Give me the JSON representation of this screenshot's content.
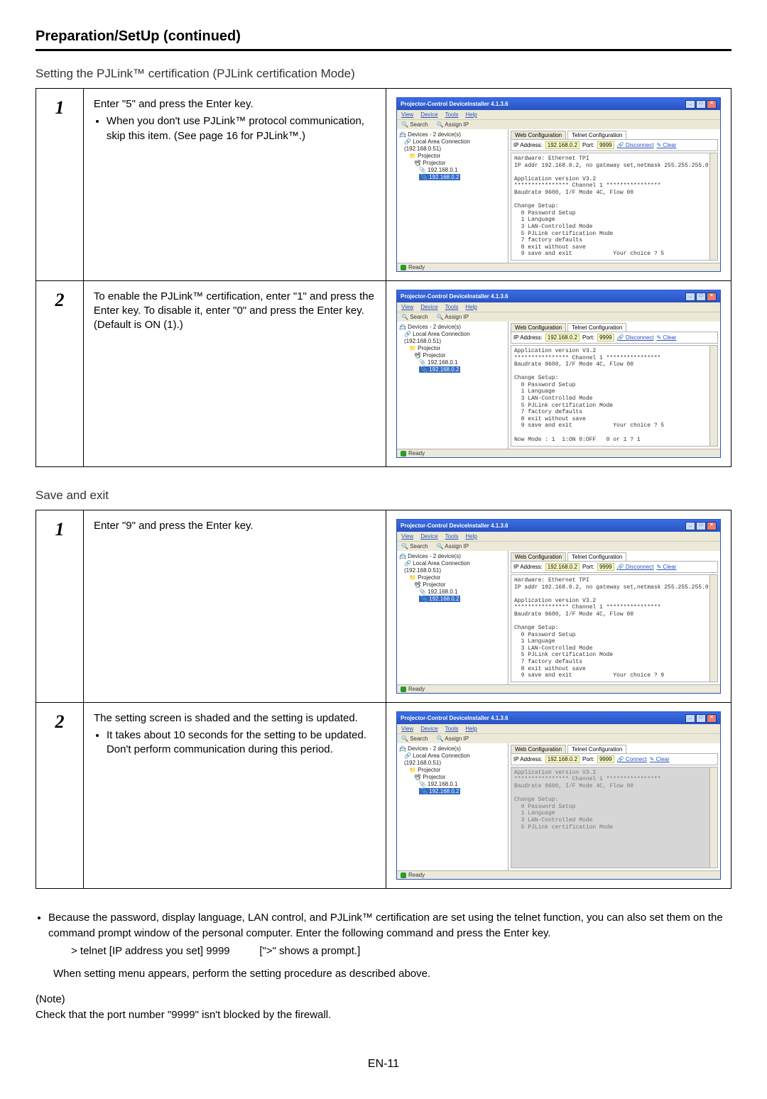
{
  "header": {
    "page_title": "Preparation/SetUp (continued)"
  },
  "section_pjlink": {
    "heading": "Setting the PJLink™ certification (PJLink certification Mode)",
    "rows": [
      {
        "num": "1",
        "desc_main": "Enter \"5\" and press the Enter key.",
        "desc_bullets": [
          "When you don't use PJLink™ protocol communication, skip this item. (See page 16 for PJLink™.)"
        ],
        "terminal_text": "Hardware: Ethernet TPI\nIP addr 192.168.0.2, no gateway set,netmask 255.255.255.0\n\nApplication version V3.2\n**************** Channel 1 ****************\nBaudrate 9600, I/F Mode 4C, Flow 00\n\nChange Setup:\n  0 Password Setup\n  1 Language\n  3 LAN-Controlled Mode\n  5 PJLink certification Mode\n  7 factory defaults\n  8 exit without save\n  9 save and exit            Your choice ? 5",
        "addr_btn": "Disconnect",
        "shaded": false
      },
      {
        "num": "2",
        "desc_main": "To enable the PJLink™ certification, enter \"1\" and press the Enter key. To disable it, enter \"0\" and press the Enter key. (Default is ON (1).)",
        "desc_bullets": [],
        "terminal_text": "Application version V3.2\n**************** Channel 1 ****************\nBaudrate 9600, I/F Mode 4C, Flow 00\n\nChange Setup:\n  0 Password Setup\n  1 Language\n  3 LAN-Controlled Mode\n  5 PJLink certification Mode\n  7 factory defaults\n  8 exit without save\n  9 save and exit            Your choice ? 5\n\nNow Mode : 1  1:ON 0:OFF   0 or 1 ? 1",
        "addr_btn": "Disconnect",
        "shaded": false
      }
    ]
  },
  "section_save": {
    "heading": "Save and exit",
    "rows": [
      {
        "num": "1",
        "desc_main": "Enter \"9\" and press the Enter key.",
        "desc_bullets": [],
        "terminal_text": "Hardware: Ethernet TPI\nIP addr 192.168.0.2, no gateway set,netmask 255.255.255.0\n\nApplication version V3.2\n**************** Channel 1 ****************\nBaudrate 9600, I/F Mode 4C, Flow 00\n\nChange Setup:\n  0 Password Setup\n  1 Language\n  3 LAN-Controlled Mode\n  5 PJLink certification Mode\n  7 factory defaults\n  8 exit without save\n  9 save and exit            Your choice ? 9",
        "addr_btn": "Disconnect",
        "shaded": false
      },
      {
        "num": "2",
        "desc_main": "The setting screen is shaded and the setting is updated.",
        "desc_bullets": [
          "It takes about 10 seconds for the setting to be updated. Don't perform communication during this period."
        ],
        "terminal_text": "Application version V3.2\n**************** Channel 1 ****************\nBaudrate 9600, I/F Mode 4C, Flow 00\n\nChange Setup:\n  0 Password Setup\n  1 Language\n  3 LAN-Controlled Mode\n  5 PJLink certification Mode",
        "addr_btn": "Connect",
        "shaded": true
      }
    ]
  },
  "screenshot_common": {
    "window_title": "Projector-Control DeviceInstaller 4.1.3.6",
    "menus": [
      "View",
      "Device",
      "Tools",
      "Help"
    ],
    "tool_search": "Search",
    "tool_assign": "Assign IP",
    "tree": {
      "root": "Devices - 2 device(s)",
      "conn": "Local Area Connection (192.168.0.51)",
      "folder": "Projector",
      "node": "Projector",
      "ip1": "192.168.0.1",
      "ip2": "192.168.0.2"
    },
    "tab_web": "Web Configuration",
    "tab_telnet": "Telnet Configuration",
    "addr_label": "IP Address:",
    "addr_ip": "192.168.0.2",
    "port_label": "Port:",
    "port_val": "9999",
    "clear": "Clear",
    "status": "Ready"
  },
  "footer": {
    "bullet": "Because the password, display language, LAN control, and PJLink™ certification are set using the telnet function, you can also set them on the command prompt window of the personal computer. Enter the following command and press the Enter key.",
    "cmd": "> telnet [IP address you set] 9999",
    "cmd_note": "[\">\" shows a prompt.]",
    "after": "When setting menu appears, perform the setting procedure as described above.",
    "note_label": "(Note)",
    "note_body": "Check that the port number \"9999\" isn't blocked by the firewall.",
    "pagenum": "EN-11"
  }
}
